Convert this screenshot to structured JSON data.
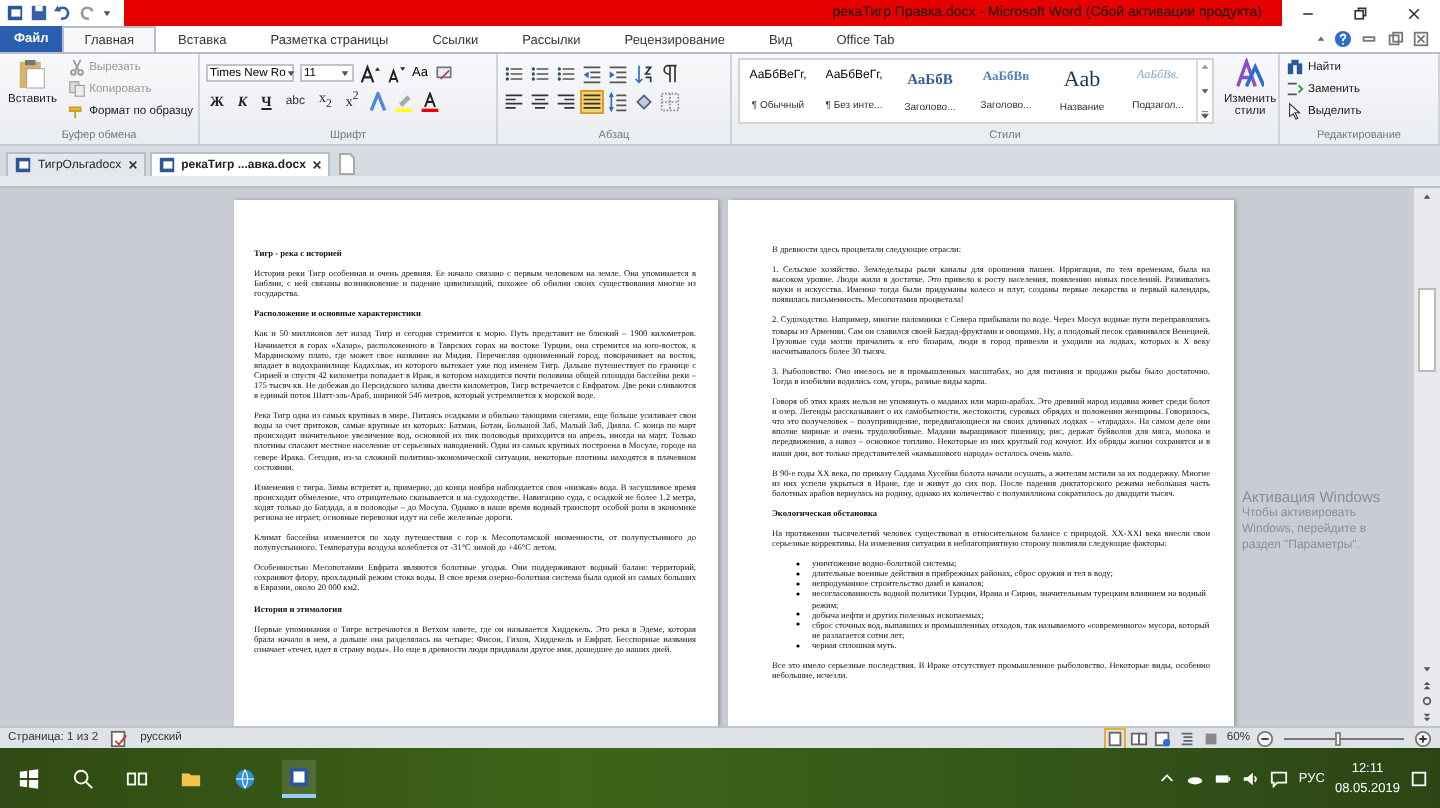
{
  "title_bar": {
    "title": "рекаТигр Правка.docx - Microsoft Word (Сбой активации продукта)"
  },
  "ribbon_tabs": [
    {
      "label": "Файл",
      "kind": "file",
      "selected": false
    },
    {
      "label": "Главная",
      "kind": "tab",
      "selected": true
    },
    {
      "label": "Вставка",
      "kind": "tab",
      "selected": false
    },
    {
      "label": "Разметка страницы",
      "kind": "tab",
      "selected": false
    },
    {
      "label": "Ссылки",
      "kind": "tab",
      "selected": false
    },
    {
      "label": "Рассылки",
      "kind": "tab",
      "selected": false
    },
    {
      "label": "Рецензирование",
      "kind": "tab",
      "selected": false
    },
    {
      "label": "Вид",
      "kind": "tab",
      "selected": false
    },
    {
      "label": "Office Tab",
      "kind": "tab",
      "selected": false
    }
  ],
  "clipboard": {
    "paste": "Вставить",
    "items": [
      "Вырезать",
      "Копировать",
      "Формат по образцу"
    ],
    "group": "Буфер обмена"
  },
  "font": {
    "family": "Times New Ro",
    "size": "11",
    "case": "Aa",
    "format_buttons": [
      {
        "text": "Ж",
        "kind": "bold"
      },
      {
        "text": "К",
        "kind": "italic"
      },
      {
        "text": "Ч",
        "kind": "underline"
      },
      {
        "text": "abc",
        "kind": "strike"
      },
      {
        "text": "x$_{2}$",
        "kind": "plain"
      },
      {
        "text": "x$^{2}$",
        "kind": "plain"
      }
    ],
    "group": "Шрифт"
  },
  "paragraph": {
    "group": "Абзац",
    "alignment": [
      {
        "kind": "left",
        "selected": false
      },
      {
        "kind": "center",
        "selected": false
      },
      {
        "kind": "right",
        "selected": false
      },
      {
        "kind": "justify",
        "selected": true
      }
    ]
  },
  "styles": {
    "group": "Стили",
    "items": [
      {
        "sample": "АаБбВеГг,",
        "name": "¶ Обычный",
        "kind": "normal"
      },
      {
        "sample": "АаБбВеГг,",
        "name": "¶ Без инте...",
        "kind": "normal"
      },
      {
        "sample": "АаБбВ",
        "name": "Заголово...",
        "kind": "heading1"
      },
      {
        "sample": "АаБбВв",
        "name": "Заголово...",
        "kind": "heading2"
      },
      {
        "sample": "Aab",
        "name": "Название",
        "kind": "title"
      },
      {
        "sample": "АаБбВв.",
        "name": "Подзагол...",
        "kind": "subtitle"
      }
    ],
    "change": "Изменить стили"
  },
  "editing": {
    "group": "Редактирование",
    "items": [
      "Найти",
      "Заменить",
      "Выделить"
    ]
  },
  "doc_tabs": [
    {
      "label": "ТигрОльгаdocx",
      "selected": false
    },
    {
      "label": "рекаТигр ...авка.docx",
      "selected": true
    }
  ],
  "pages": [
    [
      {
        "kind": "title",
        "text": "Тигр - река с историей"
      },
      {
        "kind": "p",
        "text": "История реки Тигр особенная и очень древняя. Ее начало связано с первым человеком на земле. Она упоминается в Библии, с ней связаны возникновение и падение цивилизаций, похожее об обилии своих существования многие из государства."
      },
      {
        "kind": "h",
        "text": "Расположение и основные характеристики"
      },
      {
        "kind": "p",
        "text": "Как и 50 миллионов лет назад Тигр и сегодня стремится к морю. Путь представит не близкий – 1900 километров. Начинается в горах «Хазар», расположенного в Таврских горах на востоке Турции, она стремится на юго-восток, к Мардинскому плато, где может свое название на Мидия. Перечисляя одноименный город, поворачивает на восток, впадает в водохранилище Кадахлык, из которого вытекает уже под именем Тигр. Дальше путешествует по границе с Сирией и спустя 42 километра попадает в Ирак, в котором находится почти половина общей площади бассейна реки – 175 тысяч кв. Не добежав до Персидского залива двести километров, Тигр встречается с Евфратом. Две реки сливаются в единый поток Шатт-эль-Араб, шириной 546 метров, который устремляется к морской воде."
      },
      {
        "kind": "p",
        "text": "Река Тигр одна из самых крупных в мире. Питаясь осадками и обильно тающими снегами, еще больше усиливает свои воды за счет притоков, самые крупные из которых: Батман, Ботан, Большой Заб, Малый Заб, Дияла. С конца по март происходит значительное увеличение вод, основной их пик половодья приходится на апрель, иногда на март. Только плотины спасают местное население от серьезных наводнений. Одна из самых крупных построена в Мосуле, городе на севере Ирака. Сегодня, из-за сложной политико-экономической ситуации, некоторые плотины находятся в плачевном состоянии."
      },
      {
        "kind": "p",
        "text": "Изменения с тигра. Зимы встретят и, примерно, до конца ноября наблюдается своя «низкая» вода. В засушливое время происходит обмеление, что отрицательно сказывается и на судоходстве. Навигацию суда, с осадкой не более 1.2 метра, ходят только до Багдада, а в половодье – до Мосула. Однако в наше время водный транспорт особой роли в экономике региона не играет, основные перевозки идут на себе железные дороги."
      },
      {
        "kind": "p",
        "text": "Климат бассейна изменяется по ходу путешествия с гор к Месопотамской низменности, от полупустынного до полупустынного. Температура воздуха колеблется от -31°С зимой до +46°С летом."
      },
      {
        "kind": "p",
        "text": "Особенностью Месопотамии Евфрата являются болотные угодья. Они поддерживают водный баланс территорий, сохраняют флору, прохладный режим стока воды. В свое время озерно-болотная система была одной из самых больших в Евразии, около 20 000 км2."
      },
      {
        "kind": "h",
        "text": "История и этимология"
      },
      {
        "kind": "p",
        "text": "Первые упоминания о Тигре встречаются в Ветхом завете, где он называется Хиддекель. Это река в Эдеме, которая брала начало в нем, а дальше она разделялась на четыре: Фисон, Гихон, Хиддекель и Евфрат. Бесспорные названия означает «течет, идет в страну воды». Но еще в древности люди придавали другое имя, дошедшее до наших дней."
      }
    ],
    [
      {
        "kind": "p",
        "text": "В древности здесь процветали следующие отрасли:"
      },
      {
        "kind": "p",
        "text": "1. Сельское хозяйство. Земледельцы рыли каналы для орошения пашен. Ирригация, по тем временам, была на высоком уровне. Люди жили в достатке. Это привело к росту населения, появлению новых поселений. Развивались науки и искусства. Именно тогда были придуманы колесо и плуг, созданы первые лекарства и первый календарь, появилась письменность. Месопотамия процветала!"
      },
      {
        "kind": "p",
        "text": "2. Судоходство. Например, многие паломники с Севера прибывали по воде. Через Мосул водные пути переправлялись товары из Армении. Сам он славился своей Багдад-фруктами и овощами. Ну, а плодовый песок сравнивался Венецией. Грузовые суда могли причалить к его базарам, люди в город привезли и уходили на лодках, которых к X веку насчитывалось более 30 тысяч."
      },
      {
        "kind": "p",
        "text": "3. Рыболовство. Оно имелось не в промышленных масштабах, но для питания и продажи рыбы было достаточно. Тогда в изобилии водились сом, угорь, разные виды карпа."
      },
      {
        "kind": "p",
        "text": "Говоря об этих краях нельзя не упомянуть о маданах или марш-арабах. Это древний народ издавна живет среди болот и озер. Легенды рассказывают о их самобытности, жестокости, суровых обрядах и положении женщины. Говорилось, что это получеловек – полупривидение, передвигающиеся на своих длинных лодках – «тарадах». На самом деле они вполне мирные и очень трудолюбивые. Мадани выращивают пшеницу, рис, держат буйволов для мяса, молока и передвижения, а навоз – основное топливо. Некоторые из них круглый год кочуют. Их обряды жизни сохранятся и в наши дни, вот только представителей «камышового народа» осталось очень мало."
      },
      {
        "kind": "p",
        "text": "В 90-е годы XX века, по приказу Саддама Хусейна болота начали осушать, а жителям мстили за их поддержку. Многие из них успели укрыться в Иране, где и живут до сих пор. После падения диктаторского режима небольшая часть болотных арабов вернулась на родину, однако их количество с полумиллиона сократилось до двадцати тысяч."
      },
      {
        "kind": "h",
        "text": "Экологическая обстановка"
      },
      {
        "kind": "p",
        "text": "На протяжении тысячелетий человек существовал в относительном балансе с природой. XX-XXI века внесли свои серьезные коррективы. На изменения ситуации в неблагоприятную сторону повлияли следующие факторы:"
      },
      {
        "kind": "list",
        "items": [
          "уничтожение водно-болотной системы;",
          "длительные военные действия в прибрежных районах, сброс оружия и тел в воду;",
          "непродуманное строительство дамб и каналов;",
          "несогласованность водной политики Турции, Ирана и Сирии, значительным турецким влиянием на водный режим;",
          "добыча нефти и других полезных ископаемых;",
          "сброс сточных вод, выпавших и промышленных отходов, так называемого «современного» мусора, который не разлагается сотни лет;",
          "черная сплошная муть."
        ]
      },
      {
        "kind": "p",
        "text": "Все это имело серьезные последствия. В Ираке отсутствует промышленное рыболовство. Некоторые виды, особенно небольшие, исчезли."
      }
    ]
  ],
  "activation": {
    "title": "Активация Windows",
    "text": "Чтобы активировать Windows, перейдите в раздел \"Параметры\"."
  },
  "status_bar": {
    "page": "Страница: 1 из 2",
    "language": "русский",
    "zoom": "60%",
    "zoom_slider": {
      "level": 0.45
    }
  },
  "taskbar": {
    "language": "РУС",
    "time": "12:11",
    "date": "08.05.2019"
  }
}
